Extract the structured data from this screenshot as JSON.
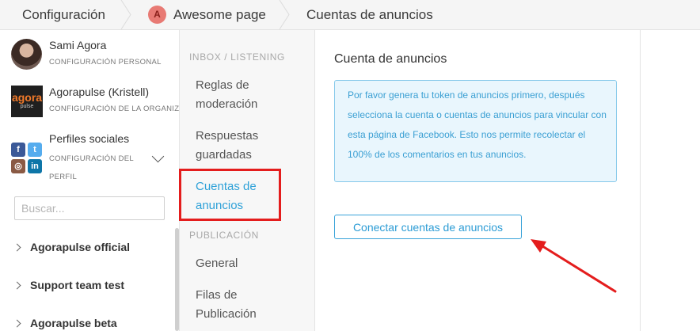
{
  "breadcrumb": {
    "item1": "Configuración",
    "avatar_letter": "A",
    "item2": "Awesome page",
    "item3": "Cuentas de anuncios"
  },
  "sidebar": {
    "profiles": [
      {
        "name": "Sami Agora",
        "sub": "CONFIGURACIÓN PERSONAL"
      },
      {
        "name": "Agorapulse (Kristell)",
        "sub": "CONFIGURACIÓN DE LA ORGANIZACIÓN",
        "logo_text": "agora",
        "logo_sub": "pulse"
      },
      {
        "name": "Perfiles sociales",
        "sub": "CONFIGURACIÓN DEL PERFIL"
      }
    ],
    "search": {
      "placeholder": "Buscar..."
    },
    "groups": [
      "Agorapulse official",
      "Support team test",
      "Agorapulse beta"
    ]
  },
  "menu": {
    "section1": "INBOX / LISTENING",
    "section1_items": [
      "Reglas de moderación",
      "Respuestas guardadas",
      "Cuentas de anuncios"
    ],
    "section2": "PUBLICACIÓN",
    "section2_items": [
      "General",
      "Filas de Publicación"
    ]
  },
  "content": {
    "title": "Cuenta de anuncios",
    "info": "Por favor genera tu token de anuncios primero, después selecciona la cuenta o cuentas de anuncios para vincular con esta página de Facebook. Esto nos permite recolectar el 100% de los comentarios en tus anuncios.",
    "button": "Conectar cuentas de anuncios"
  },
  "colors": {
    "accent": "#2ea1d8",
    "highlight": "#e41d1d",
    "avatar_bg": "#e87a74"
  },
  "icons": [
    "facebook-icon",
    "twitter-icon",
    "instagram-icon",
    "linkedin-icon",
    "chevron-down-icon"
  ]
}
